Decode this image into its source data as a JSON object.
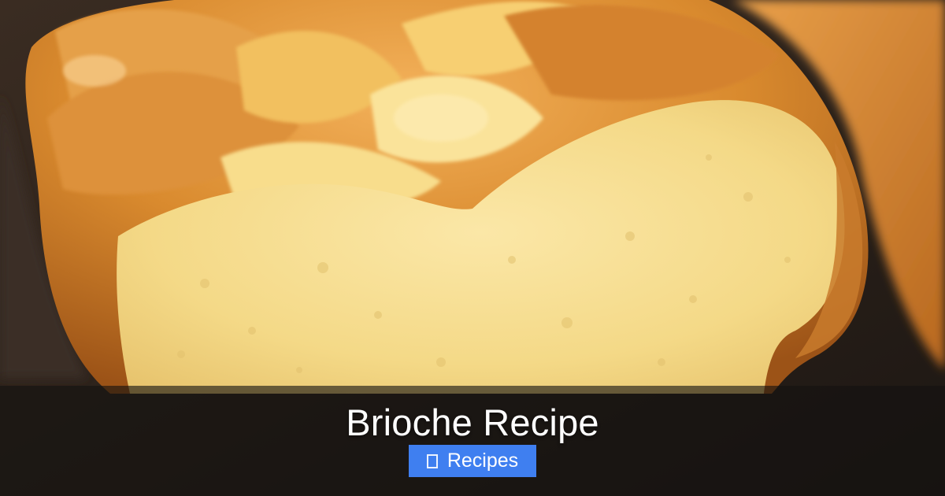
{
  "hero": {
    "title": "Brioche Recipe",
    "image_subject": "sliced braided brioche loaf"
  },
  "category_badge": {
    "icon": "folder-icon",
    "label": "Recipes"
  },
  "colors": {
    "badge_background": "#3f7ff0",
    "overlay": "#141210",
    "title_text": "#ffffff"
  }
}
